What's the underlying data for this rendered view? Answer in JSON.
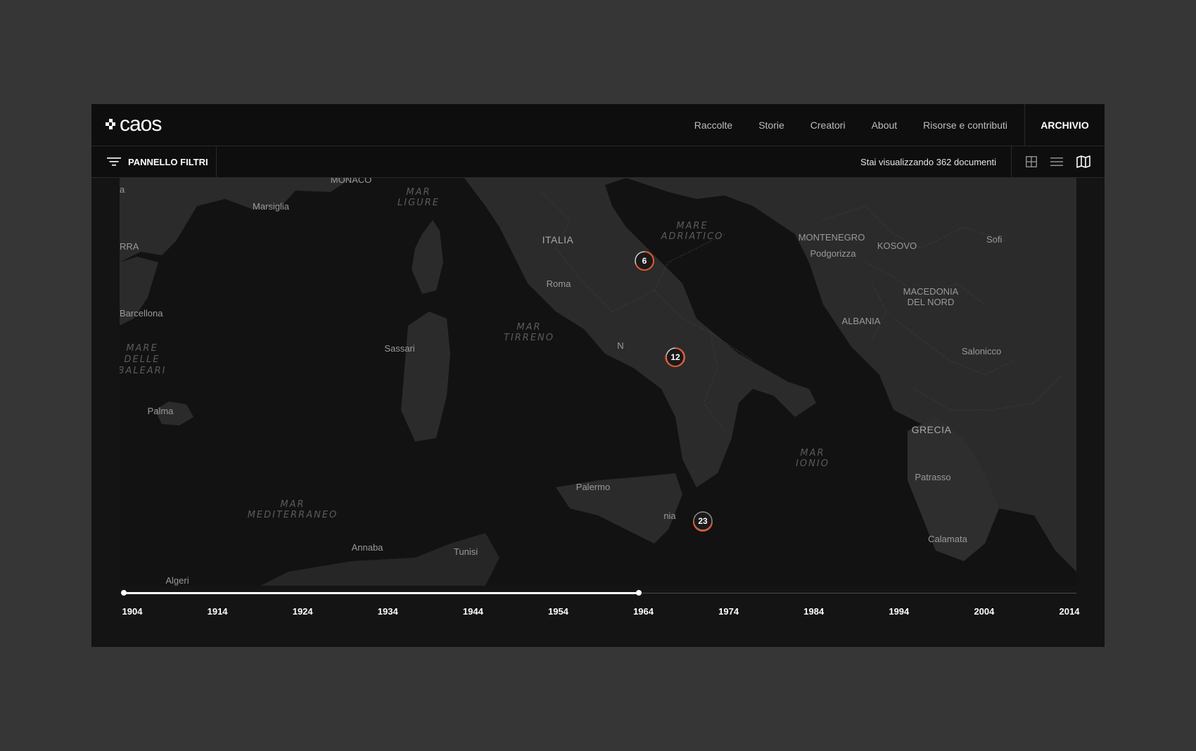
{
  "header": {
    "logo_text": "caos",
    "nav": [
      "Raccolte",
      "Storie",
      "Creatori",
      "About",
      "Risorse e contributi"
    ],
    "archive_label": "ARCHIVIO"
  },
  "toolbar": {
    "filters_label": "PANNELLO FILTRI",
    "count_text": "Stai visualizzando 362 documenti",
    "views": [
      "grid-view-icon",
      "list-view-icon",
      "map-view-icon"
    ],
    "active_view": "map"
  },
  "map": {
    "labels": {
      "monaco": "MONACO",
      "marsiglia": "Marsiglia",
      "barcellona": "Barcellona",
      "palma": "Palma",
      "sassari": "Sassari",
      "roma": "Roma",
      "italia": "ITALIA",
      "napoli": "N",
      "palermo": "Palermo",
      "catania": "nia",
      "algeri": "Algeri",
      "annaba": "Annaba",
      "tunisi": "Tunisi",
      "montenegro": "MONTENEGRO",
      "podgorizza": "Podgorizza",
      "kosovo": "KOSOVO",
      "sofia": "Sofi",
      "macedonia_1": "MACEDONIA",
      "macedonia_2": "DEL NORD",
      "albania": "ALBANIA",
      "salonicco": "Salonicco",
      "grecia": "GRECIA",
      "patrasso": "Patrasso",
      "calamata": "Calamata",
      "edge_a": "a",
      "edge_rra": "RRA"
    },
    "seas": {
      "ligure_1": "MAR",
      "ligure_2": "LIGURE",
      "adriatico_1": "MARE",
      "adriatico_2": "ADRIATICO",
      "tirreno_1": "MAR",
      "tirreno_2": "TIRRENO",
      "baleari_1": "MARE",
      "baleari_2": "DELLE",
      "baleari_3": "BALEARI",
      "ionio_1": "MAR",
      "ionio_2": "IONIO",
      "mediterraneo_1": "MAR",
      "mediterraneo_2": "MEDITERRANEO"
    },
    "markers": [
      {
        "id": "marker-6",
        "count": "6"
      },
      {
        "id": "marker-12",
        "count": "12"
      },
      {
        "id": "marker-23",
        "count": "23"
      }
    ]
  },
  "timeline": {
    "years": [
      "1904",
      "1914",
      "1924",
      "1934",
      "1944",
      "1954",
      "1964",
      "1974",
      "1984",
      "1994",
      "2004",
      "2014"
    ],
    "range_start": "1904",
    "range_end": 1963.5
  },
  "colors": {
    "background": "#363636",
    "panel": "#141414",
    "marker_ring": "#e8552f",
    "land": "#2b2b2b",
    "sea": "#121212"
  }
}
